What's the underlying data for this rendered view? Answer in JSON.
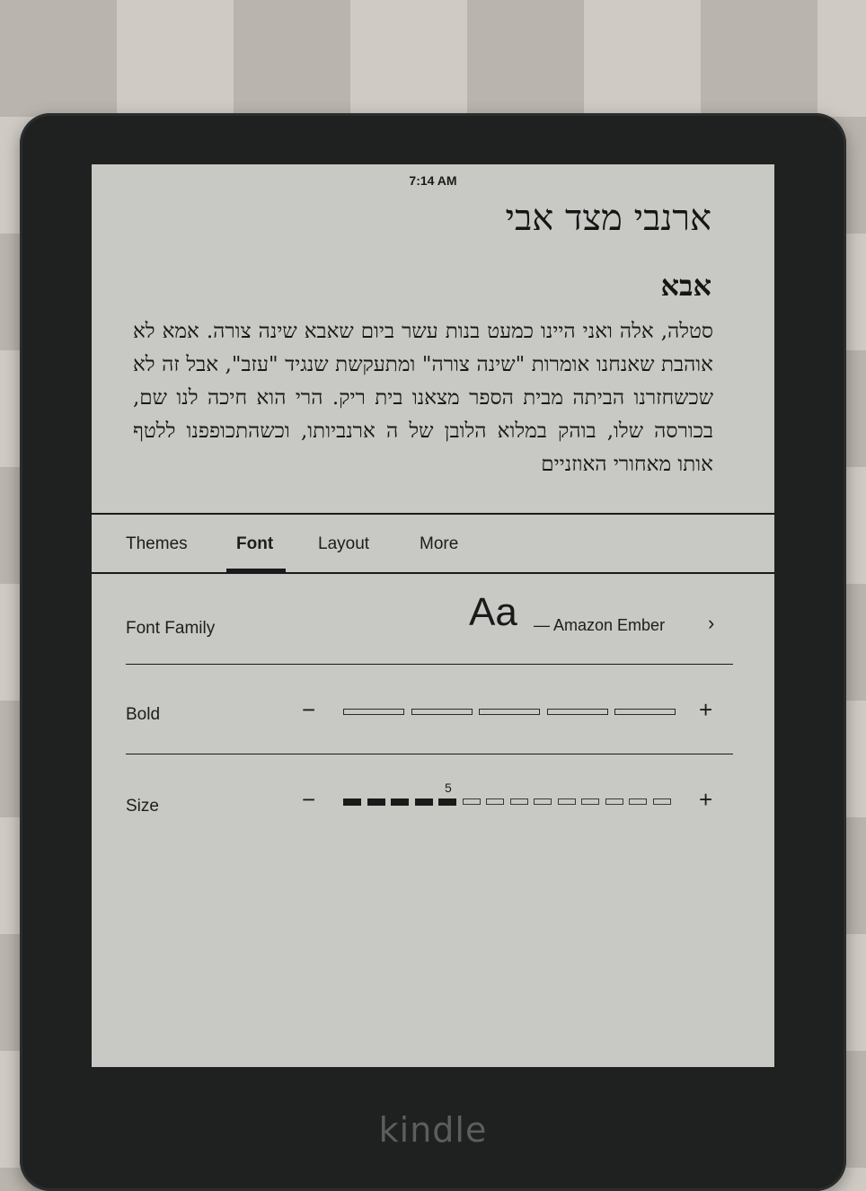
{
  "status_bar": {
    "time": "7:14 AM"
  },
  "book": {
    "title": "ארנבי מצד אבי",
    "chapter": "אבא",
    "text": "סטלה, אלה ואני היינו כמעט בנות עשר ביום שאבא שינה צורה. אמא לא אוהבת שאנחנו אומרות \"שינה צורה\" ומתעקשת שנגיד \"עזב\", אבל זה לא שכשחזרנו הביתה מבית הספר מצאנו בית ריק. הרי הוא חיכה לנו שם, בכורסה שלו, בוהק במלוא הלובן של ה ארנביותו, וכשהתכופפנו ללטף אותו מאחורי האוזניים"
  },
  "tabs": [
    {
      "label": "Themes",
      "active": false
    },
    {
      "label": "Font",
      "active": true
    },
    {
      "label": "Layout",
      "active": false
    },
    {
      "label": "More",
      "active": false
    }
  ],
  "font_family": {
    "label": "Font Family",
    "sample": "Aa",
    "value": "— Amazon Ember",
    "chevron": "›"
  },
  "bold": {
    "label": "Bold",
    "minus": "−",
    "plus": "+",
    "level": 0,
    "segments": 5
  },
  "size": {
    "label": "Size",
    "minus": "−",
    "plus": "+",
    "value": "5",
    "level": 5,
    "segments": 14
  },
  "device": {
    "brand": "kindle"
  },
  "colors": {
    "screen": "#c8c9c4",
    "ink": "#1a1a1a",
    "bezel": "#1f2120"
  }
}
